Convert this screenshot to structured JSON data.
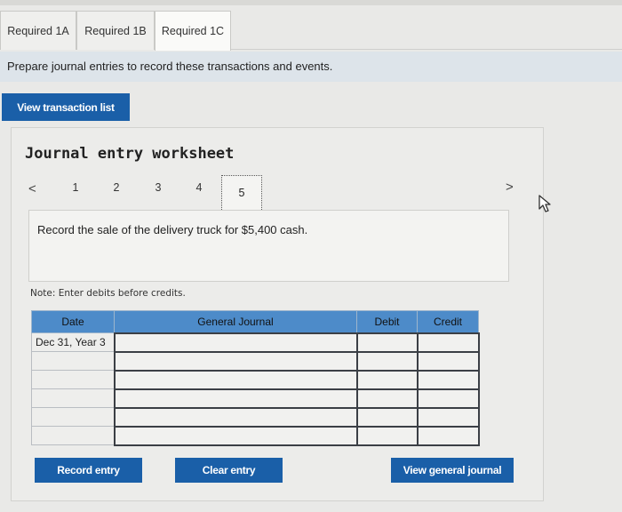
{
  "tabs": [
    {
      "label": "Required 1A"
    },
    {
      "label": "Required 1B"
    },
    {
      "label": "Required 1C"
    }
  ],
  "instruction": "Prepare journal entries to record these transactions and events.",
  "view_transaction_list": "View transaction list",
  "worksheet": {
    "title": "Journal entry worksheet",
    "prev": "<",
    "next": ">",
    "pages": [
      "1",
      "2",
      "3",
      "4",
      "5"
    ],
    "description": "Record the sale of the delivery truck for $5,400 cash.",
    "note": "Note: Enter debits before credits."
  },
  "table": {
    "headers": {
      "date": "Date",
      "journal": "General Journal",
      "debit": "Debit",
      "credit": "Credit"
    },
    "first_date": "Dec 31, Year 3"
  },
  "buttons": {
    "record": "Record entry",
    "clear": "Clear entry",
    "view_general_journal": "View general journal"
  },
  "colors": {
    "button": "#1a5fa8",
    "table_header": "#4d8bc9",
    "instruction_bar": "#dde4ea"
  }
}
